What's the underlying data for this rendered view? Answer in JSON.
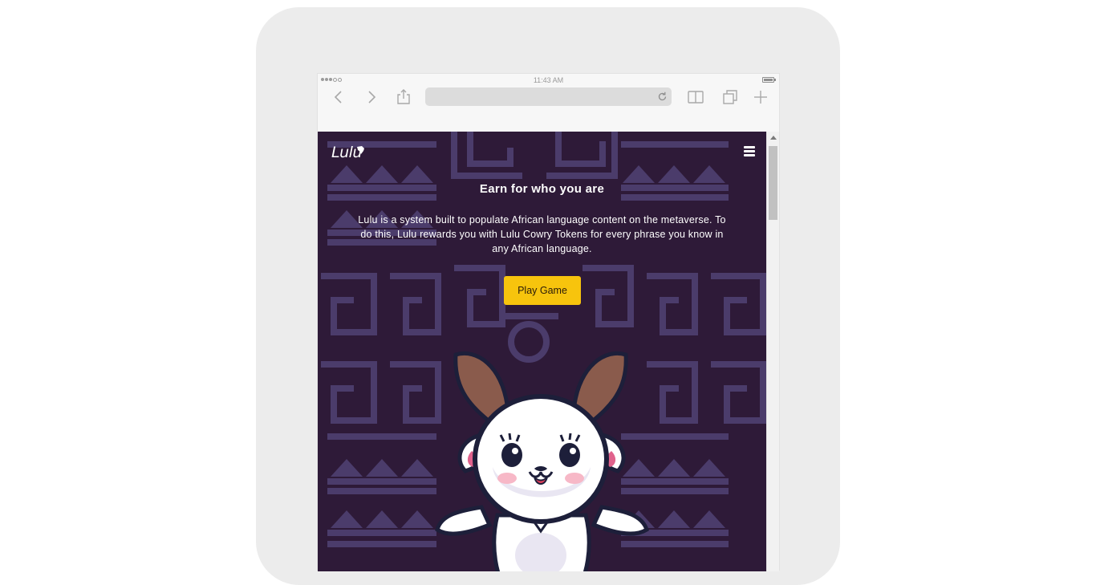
{
  "device": {
    "status_time": "11:43 AM"
  },
  "browser": {
    "url": ""
  },
  "site": {
    "logo_text": "Lulu",
    "hero": {
      "title": "Earn for who you are",
      "description": "Lulu is a system built to populate African language content on the metaverse. To do this, Lulu rewards you with Lulu Cowry Tokens for every phrase you know in any African language.",
      "cta_label": "Play Game"
    }
  },
  "colors": {
    "page_background": "#2e1a38",
    "pattern": "#4b3c6b",
    "cta_background": "#f7c40d",
    "text": "#ffffff"
  },
  "icons": [
    "back-icon",
    "forward-icon",
    "share-icon",
    "reload-icon",
    "reader-icon",
    "tabs-icon",
    "new-tab-icon",
    "menu-icon",
    "africa-icon"
  ]
}
